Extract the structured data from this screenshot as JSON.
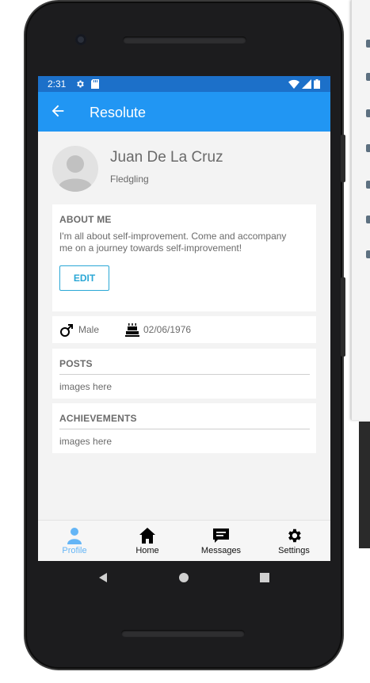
{
  "status_bar": {
    "time": "2:31"
  },
  "app_bar": {
    "title": "Resolute"
  },
  "profile": {
    "name": "Juan De La Cruz",
    "rank": "Fledgling"
  },
  "about": {
    "heading": "ABOUT ME",
    "text_line1": "I'm all about self-improvement. Come and accompany",
    "text_line2": "me on a journey towards self-improvement!",
    "edit_label": "EDIT"
  },
  "info": {
    "gender": "Male",
    "birthdate": "02/06/1976"
  },
  "posts": {
    "heading": "POSTS",
    "content": "images here"
  },
  "achievements": {
    "heading": "ACHIEVEMENTS",
    "content": "images here"
  },
  "bottom_nav": [
    {
      "label": "Profile",
      "icon": "person-icon",
      "active": true
    },
    {
      "label": "Home",
      "icon": "home-icon",
      "active": false
    },
    {
      "label": "Messages",
      "icon": "message-icon",
      "active": false
    },
    {
      "label": "Settings",
      "icon": "gear-icon",
      "active": false
    }
  ],
  "colors": {
    "primary": "#2196f3",
    "status_bar": "#1c70c9",
    "accent": "#2aa7d6",
    "active_nav": "#64b5f6"
  }
}
